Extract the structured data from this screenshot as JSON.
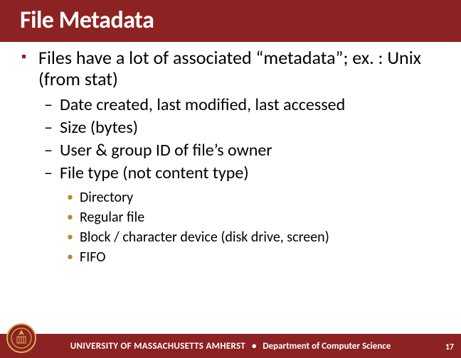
{
  "title": "File Metadata",
  "bullets": {
    "main": "Files have a lot of associated “metadata”; ex. : Unix (from stat)",
    "sub": [
      "Date created, last modified, last accessed",
      "Size (bytes)",
      "User & group ID of file’s owner",
      "File type (not content type)"
    ],
    "subsub": [
      "Directory",
      "Regular file",
      "Block / character device (disk drive, screen)",
      "FIFO"
    ]
  },
  "footer": {
    "university": "UNIVERSITY OF MASSACHUSETTS AMHERST",
    "separator": "•",
    "department": "Department of Computer Science",
    "page": "17"
  }
}
